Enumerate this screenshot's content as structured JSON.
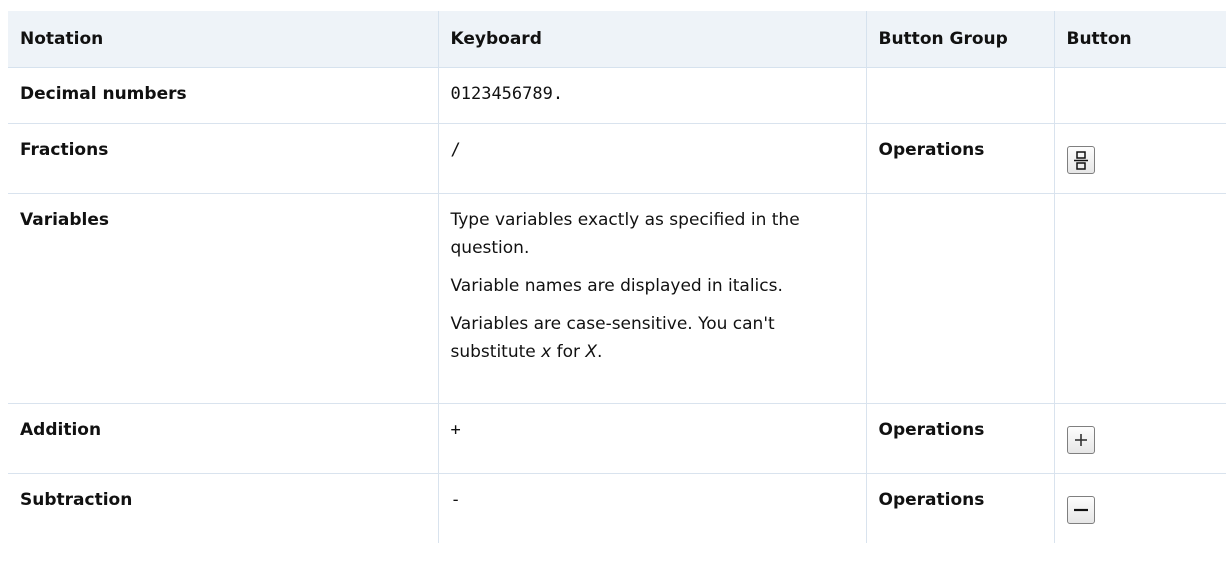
{
  "table": {
    "headers": {
      "notation": "Notation",
      "keyboard": "Keyboard",
      "button_group": "Button Group",
      "button": "Button"
    },
    "rows": [
      {
        "notation": "Decimal numbers",
        "keyboard": "0123456789.",
        "button_group": "",
        "button_icon": ""
      },
      {
        "notation": "Fractions",
        "keyboard": "/",
        "button_group": "Operations",
        "button_icon": "fraction-icon"
      },
      {
        "notation": "Variables",
        "keyboard_paragraphs": {
          "p1": "Type variables exactly as specified in the question.",
          "p2": "Variable names are displayed in italics.",
          "p3_prefix": "Variables are case-sensitive. You can't substitute ",
          "p3_var1": "x",
          "p3_mid": " for ",
          "p3_var2": "X",
          "p3_suffix": "."
        },
        "button_group": "",
        "button_icon": ""
      },
      {
        "notation": "Addition",
        "keyboard": "+",
        "button_group": "Operations",
        "button_icon": "plus-icon"
      },
      {
        "notation": "Subtraction",
        "keyboard": "-",
        "button_group": "Operations",
        "button_icon": "minus-icon"
      }
    ]
  },
  "colors": {
    "header_background": "#eef3f8",
    "border": "#d9e3ee"
  }
}
